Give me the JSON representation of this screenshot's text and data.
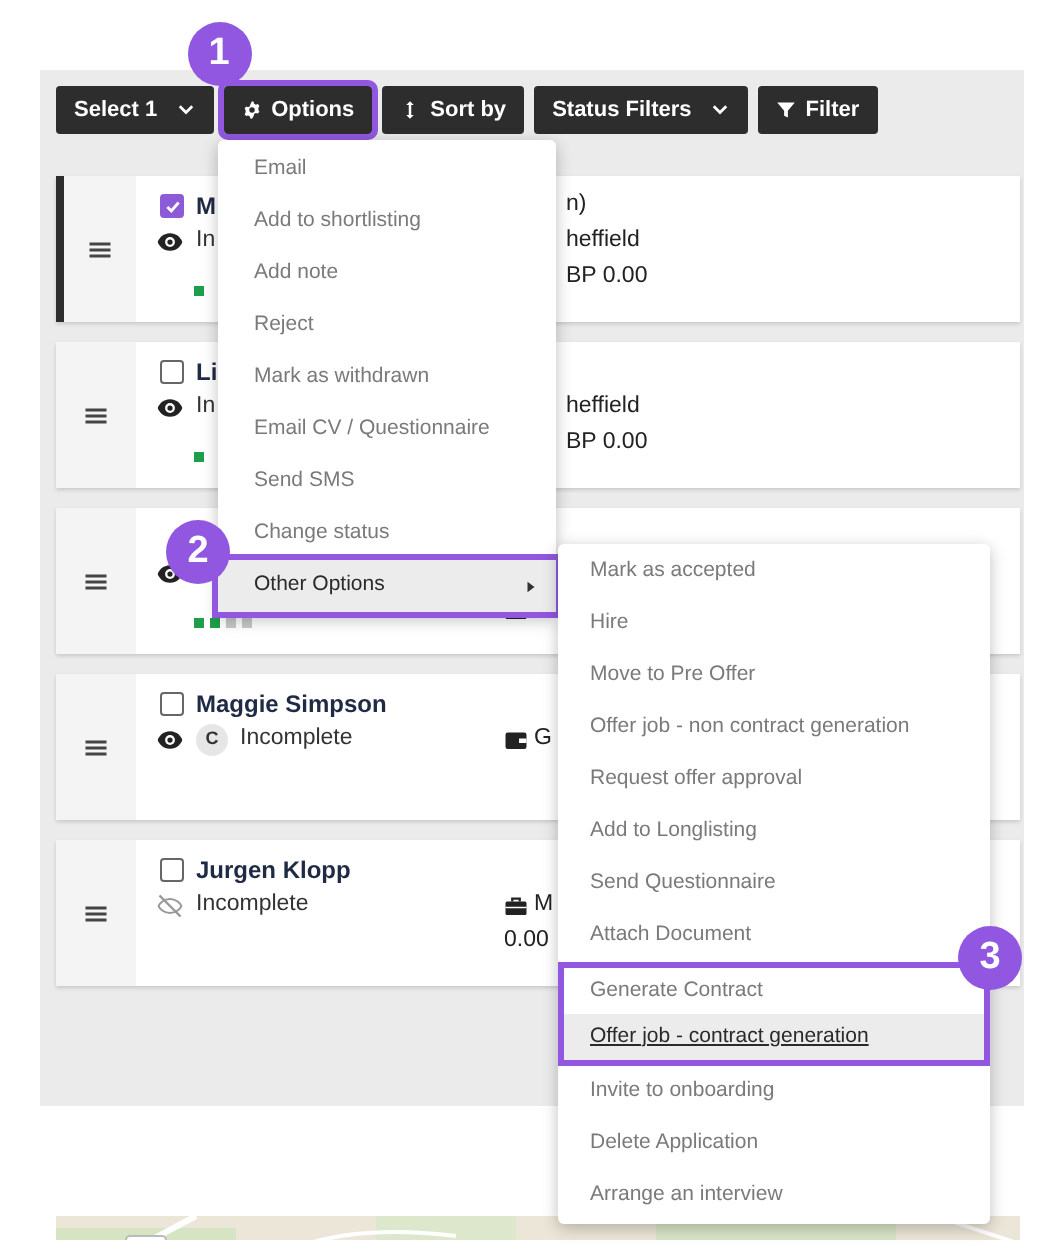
{
  "toolbar": {
    "buttons": [
      {
        "label": "Select 1",
        "kind": "dropdown",
        "highlighted": false
      },
      {
        "label": "Options",
        "kind": "gear",
        "highlighted": true,
        "callout": "1"
      },
      {
        "label": "Sort by",
        "kind": "sort",
        "highlighted": false
      },
      {
        "label": "Status Filters",
        "kind": "dropdown",
        "highlighted": false
      },
      {
        "label": "Filter",
        "kind": "filter",
        "highlighted": false
      }
    ]
  },
  "cards": [
    {
      "selected": true,
      "checked": true,
      "name": "M",
      "watched": true,
      "status": "In",
      "steps": [
        {
          "done": true
        }
      ],
      "details": [
        {
          "kind": "offset",
          "text": "n)"
        },
        {
          "kind": "offset",
          "text": "heffield"
        },
        {
          "kind": "offset",
          "text": "BP 0.00"
        }
      ]
    },
    {
      "selected": false,
      "checked": false,
      "name": "Li",
      "watched": true,
      "status": "In",
      "steps": [
        {
          "done": true
        }
      ],
      "details": [
        {
          "kind": "spacer"
        },
        {
          "kind": "offset",
          "text": "heffield"
        },
        {
          "kind": "offset",
          "text": "BP 0.00"
        }
      ]
    },
    {
      "selected": false,
      "watched": true,
      "steps": [
        {
          "done": true
        },
        {
          "done": true
        },
        {
          "done": false
        },
        {
          "done": false
        }
      ],
      "details": [
        {
          "kind": "spacer"
        },
        {
          "kind": "spacer"
        },
        {
          "kind": "briefcase"
        }
      ]
    },
    {
      "selected": false,
      "checked": false,
      "name": "Maggie Simpson",
      "watched": true,
      "avatar": "C",
      "status": "Incomplete",
      "details": [
        {
          "kind": "spacer"
        },
        {
          "kind": "wallet",
          "text": "G"
        }
      ]
    },
    {
      "selected": false,
      "checked": false,
      "name": "Jurgen Klopp",
      "watched": false,
      "status": "Incomplete",
      "details": [
        {
          "kind": "spacer"
        },
        {
          "kind": "briefcase",
          "text": "M"
        },
        {
          "kind": "text",
          "text": "0.00"
        }
      ]
    }
  ],
  "options_menu": {
    "items": [
      {
        "label": "Email",
        "selected": false,
        "highlighted": false
      },
      {
        "label": "Add to shortlisting",
        "selected": false,
        "highlighted": false
      },
      {
        "label": "Add note",
        "selected": false,
        "highlighted": false
      },
      {
        "label": "Reject",
        "selected": false,
        "highlighted": false
      },
      {
        "label": "Mark as withdrawn",
        "selected": false,
        "highlighted": false
      },
      {
        "label": "Email CV / Questionnaire",
        "selected": false,
        "highlighted": false
      },
      {
        "label": "Send SMS",
        "selected": false,
        "highlighted": false
      },
      {
        "label": "Change status",
        "selected": false,
        "highlighted": false
      },
      {
        "label": "Other Options",
        "selected": true,
        "highlighted": true,
        "submenu": true,
        "callout": "2"
      }
    ]
  },
  "submenu": {
    "items": [
      {
        "label": "Mark as accepted",
        "selected": false,
        "highlighted": false
      },
      {
        "label": "Hire",
        "selected": false,
        "highlighted": false
      },
      {
        "label": "Move to Pre Offer",
        "selected": false,
        "highlighted": false
      },
      {
        "label": "Offer job - non contract generation",
        "selected": false,
        "highlighted": false
      },
      {
        "label": "Request offer approval",
        "selected": false,
        "highlighted": false
      },
      {
        "label": "Add to Longlisting",
        "selected": false,
        "highlighted": false
      },
      {
        "label": "Send Questionnaire",
        "selected": false,
        "highlighted": false
      },
      {
        "label": "Attach Document",
        "selected": false,
        "highlighted": false
      },
      {
        "label": "Generate Contract",
        "selected": false,
        "highlighted": true,
        "callout": "3"
      },
      {
        "label": "Offer job - contract generation",
        "selected": true,
        "highlighted": true
      },
      {
        "label": "Invite to onboarding",
        "selected": false,
        "highlighted": false
      },
      {
        "label": "Delete Application",
        "selected": false,
        "highlighted": false
      },
      {
        "label": "Arrange an interview",
        "selected": false,
        "highlighted": false
      }
    ]
  }
}
